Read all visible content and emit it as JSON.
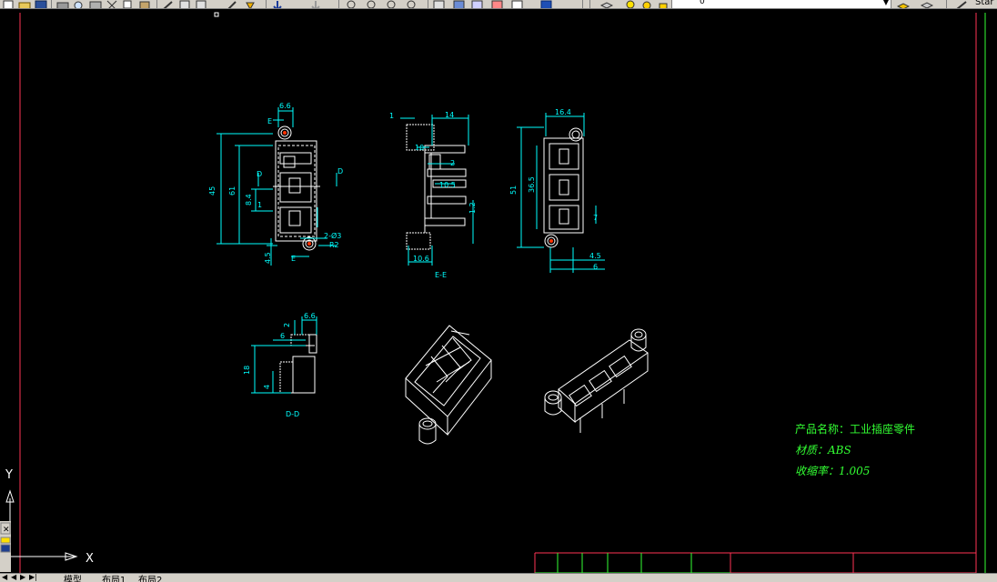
{
  "toolbar": {
    "layer_value": "0",
    "style_label": "Star",
    "icons": [
      "new-file-icon",
      "open-icon",
      "save-icon",
      "plot-icon",
      "preview-icon",
      "publish-icon",
      "cut-icon",
      "copy-icon",
      "paste-icon",
      "match-icon",
      "undo-icon",
      "redo-icon",
      "pan-icon",
      "zoom-icon",
      "zoom-window-icon",
      "zoom-previous-icon",
      "properties-icon",
      "design-center-icon",
      "tool-palette-icon",
      "markup-icon",
      "calculator-icon",
      "help-icon",
      "layer-icon",
      "layer-state-icon"
    ]
  },
  "drawing": {
    "views": {
      "front": {
        "dims": [
          "6.6",
          "45",
          "61",
          "8.4",
          "1",
          "2-Ø3",
          "R2",
          "4.5",
          "E",
          "E",
          "D",
          "D"
        ]
      },
      "section_ee": {
        "dims": [
          "1",
          "14",
          "10",
          "2",
          "10.5",
          "1.2",
          "10.6"
        ],
        "label": "E-E"
      },
      "side": {
        "dims": [
          "16.4",
          "51",
          "36.5",
          "7",
          "4.5",
          "6"
        ]
      },
      "section_dd": {
        "dims": [
          "2",
          "6.6",
          "6",
          "18",
          "4"
        ],
        "label": "D-D"
      }
    },
    "annotation": {
      "product_name": "产品名称：工业插座零件",
      "material": "材质：ABS",
      "shrinkage": "收缩率：1.005"
    },
    "ucs": {
      "x_label": "X",
      "y_label": "Y"
    }
  },
  "tabs": {
    "model": "模型",
    "layout1": "布局1",
    "layout2": "布局2"
  },
  "colors": {
    "background": "#000000",
    "dimension": "#00ffff",
    "geometry": "#ffffff",
    "annotation": "#33ff33",
    "frame": "#ff0033",
    "center_mark": "#ff3300"
  }
}
